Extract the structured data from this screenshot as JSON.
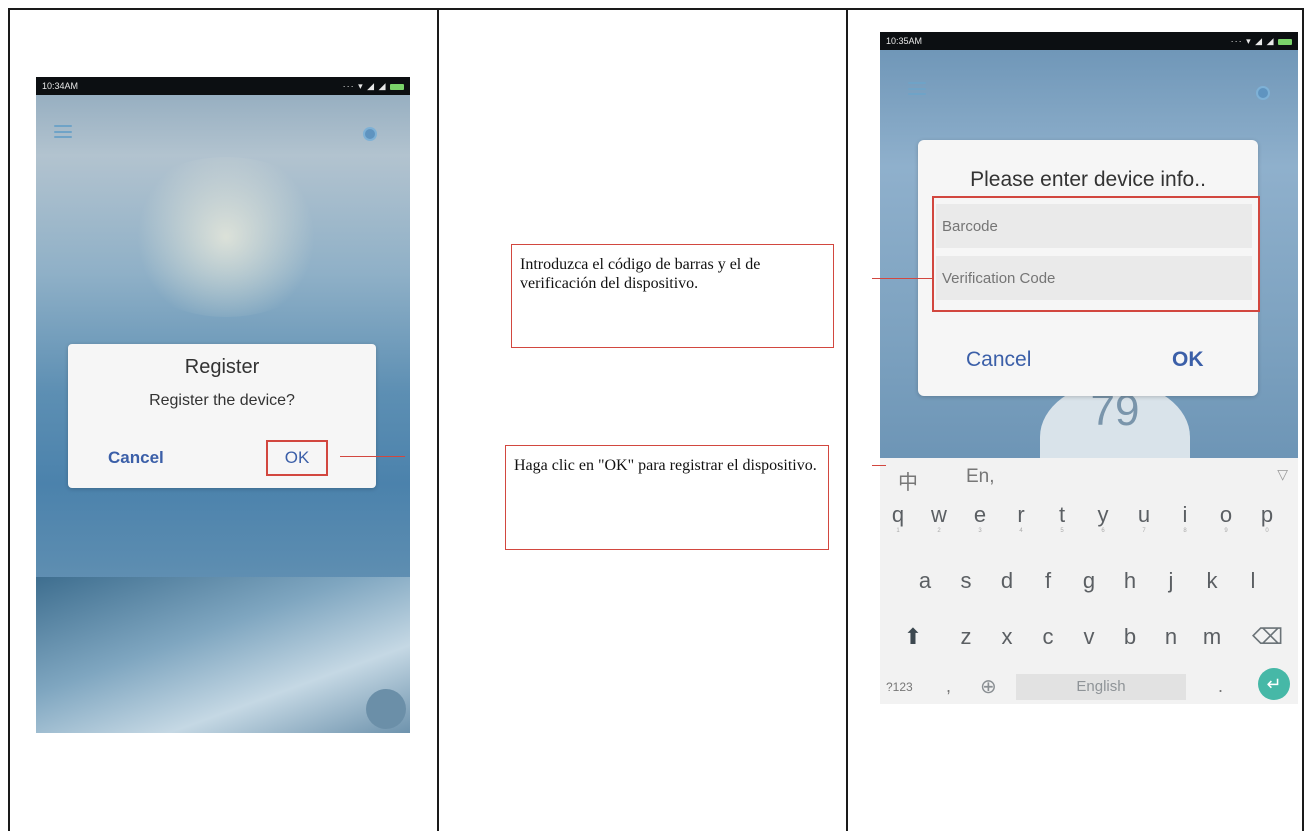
{
  "left_phone": {
    "status_time": "10:34AM",
    "dialog": {
      "title": "Register",
      "message": "Register the device?",
      "cancel_label": "Cancel",
      "ok_label": "OK"
    }
  },
  "middle": {
    "callout_top": "Introduzca el código de barras y el de verificación del dispositivo.",
    "callout_bottom": "Haga clic en \"OK\" para registrar el dispositivo."
  },
  "right_phone": {
    "status_time": "10:35AM",
    "background_number": "79",
    "dialog": {
      "title": "Please enter device info..",
      "barcode_placeholder": "Barcode",
      "verification_placeholder": "Verification Code",
      "cancel_label": "Cancel",
      "ok_label": "OK"
    },
    "keyboard": {
      "lang_cn": "中",
      "lang_en": "En,",
      "collapse": "▽",
      "row1": [
        "q",
        "w",
        "e",
        "r",
        "t",
        "y",
        "u",
        "i",
        "o",
        "p"
      ],
      "row1_sub": [
        "1",
        "2",
        "3",
        "4",
        "5",
        "6",
        "7",
        "8",
        "9",
        "0"
      ],
      "row2": [
        "a",
        "s",
        "d",
        "f",
        "g",
        "h",
        "j",
        "k",
        "l"
      ],
      "row3": [
        "z",
        "x",
        "c",
        "v",
        "b",
        "n",
        "m"
      ],
      "num_label": "?123",
      "comma": ",",
      "space_label": "English",
      "period": "."
    }
  }
}
